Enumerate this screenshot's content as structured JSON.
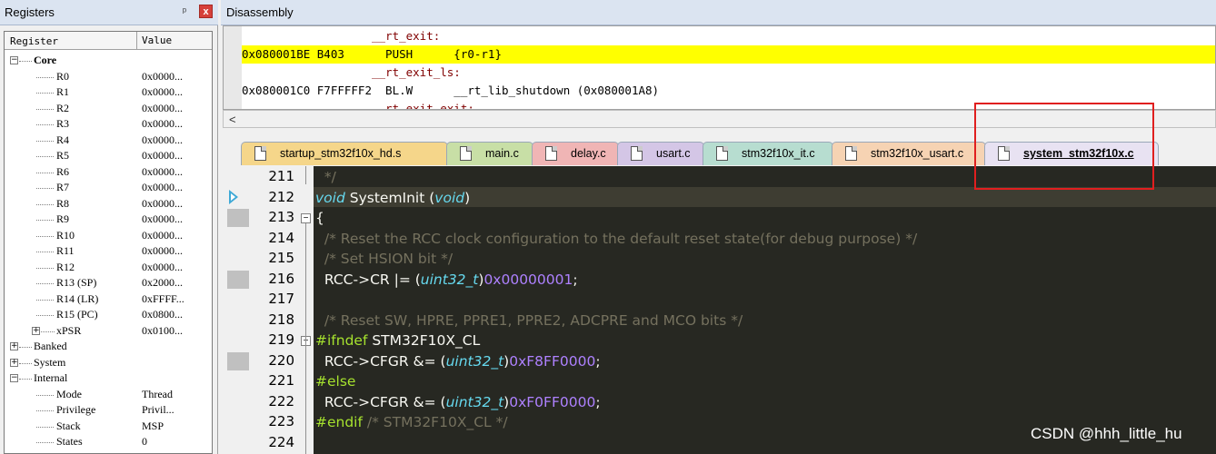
{
  "registers": {
    "title": "Registers",
    "pin_glyph": "ᵖ",
    "close_glyph": "x",
    "col_register": "Register",
    "col_value": "Value",
    "rows": [
      {
        "name": "Core",
        "value": "",
        "indent": 0,
        "toggle": "−",
        "bold": true
      },
      {
        "name": "R0",
        "value": "0x0000...",
        "indent": 2
      },
      {
        "name": "R1",
        "value": "0x0000...",
        "indent": 2
      },
      {
        "name": "R2",
        "value": "0x0000...",
        "indent": 2
      },
      {
        "name": "R3",
        "value": "0x0000...",
        "indent": 2
      },
      {
        "name": "R4",
        "value": "0x0000...",
        "indent": 2
      },
      {
        "name": "R5",
        "value": "0x0000...",
        "indent": 2
      },
      {
        "name": "R6",
        "value": "0x0000...",
        "indent": 2
      },
      {
        "name": "R7",
        "value": "0x0000...",
        "indent": 2
      },
      {
        "name": "R8",
        "value": "0x0000...",
        "indent": 2
      },
      {
        "name": "R9",
        "value": "0x0000...",
        "indent": 2
      },
      {
        "name": "R10",
        "value": "0x0000...",
        "indent": 2
      },
      {
        "name": "R11",
        "value": "0x0000...",
        "indent": 2
      },
      {
        "name": "R12",
        "value": "0x0000...",
        "indent": 2
      },
      {
        "name": "R13 (SP)",
        "value": "0x2000...",
        "indent": 2
      },
      {
        "name": "R14 (LR)",
        "value": "0xFFFF...",
        "indent": 2
      },
      {
        "name": "R15 (PC)",
        "value": "0x0800...",
        "indent": 2
      },
      {
        "name": "xPSR",
        "value": "0x0100...",
        "indent": 1,
        "toggle": "+"
      },
      {
        "name": "Banked",
        "value": "",
        "indent": 0,
        "toggle": "+"
      },
      {
        "name": "System",
        "value": "",
        "indent": 0,
        "toggle": "+"
      },
      {
        "name": "Internal",
        "value": "",
        "indent": 0,
        "toggle": "−"
      },
      {
        "name": "Mode",
        "value": "Thread",
        "indent": 2
      },
      {
        "name": "Privilege",
        "value": "Privil...",
        "indent": 2
      },
      {
        "name": "Stack",
        "value": "MSP",
        "indent": 2
      },
      {
        "name": "States",
        "value": "0",
        "indent": 2
      }
    ]
  },
  "disassembly": {
    "title": "Disassembly",
    "lines": [
      {
        "text": "                   __rt_exit:",
        "kind": "label"
      },
      {
        "text": "0x080001BE B403      PUSH      {r0-r1}",
        "kind": "highlight"
      },
      {
        "text": "                   __rt_exit_ls:",
        "kind": "label"
      },
      {
        "text": "0x080001C0 F7FFFFF2  BL.W      __rt_lib_shutdown (0x080001A8)",
        "kind": "normal"
      },
      {
        "text": "                   __rt_exit_exit:",
        "kind": "label"
      }
    ],
    "scroll_left_glyph": "<"
  },
  "tabs": [
    {
      "label": "startup_stm32f10x_hd.s",
      "color": "#f5d68a",
      "active": false
    },
    {
      "label": "main.c",
      "color": "#c8dfa6",
      "active": false
    },
    {
      "label": "delay.c",
      "color": "#f0b5b5",
      "active": false
    },
    {
      "label": "usart.c",
      "color": "#d4c6e6",
      "active": false
    },
    {
      "label": "stm32f10x_it.c",
      "color": "#b7ddd0",
      "active": false
    },
    {
      "label": "stm32f10x_usart.c",
      "color": "#f6d3b3",
      "active": false
    },
    {
      "label": "system_stm32f10x.c",
      "color": "#e8e2f2",
      "active": true
    }
  ],
  "editor": {
    "current_line": "212",
    "lines": [
      {
        "num": "211",
        "parts": [
          {
            "t": "  */",
            "c": "cm"
          }
        ]
      },
      {
        "num": "212",
        "parts": [
          {
            "t": "void",
            "c": "kw"
          },
          {
            "t": " SystemInit (",
            "c": "op"
          },
          {
            "t": "void",
            "c": "kw"
          },
          {
            "t": ")",
            "c": "op"
          }
        ]
      },
      {
        "num": "213",
        "parts": [
          {
            "t": "{",
            "c": "op"
          }
        ],
        "fold": "−"
      },
      {
        "num": "214",
        "parts": [
          {
            "t": "  /* Reset the RCC clock configuration to the default reset state(for debug purpose) */",
            "c": "cm"
          }
        ]
      },
      {
        "num": "215",
        "parts": [
          {
            "t": "  /* Set HSION bit */",
            "c": "cm"
          }
        ]
      },
      {
        "num": "216",
        "parts": [
          {
            "t": "  RCC->CR |= (",
            "c": "op"
          },
          {
            "t": "uint32_t",
            "c": "kw"
          },
          {
            "t": ")",
            "c": "op"
          },
          {
            "t": "0x00000001",
            "c": "num"
          },
          {
            "t": ";",
            "c": "op"
          }
        ]
      },
      {
        "num": "217",
        "parts": [
          {
            "t": "",
            "c": "op"
          }
        ]
      },
      {
        "num": "218",
        "parts": [
          {
            "t": "  /* Reset SW, HPRE, PPRE1, PPRE2, ADCPRE and MCO bits */",
            "c": "cm"
          }
        ]
      },
      {
        "num": "219",
        "parts": [
          {
            "t": "#ifndef",
            "c": "pp"
          },
          {
            "t": " STM32F10X_CL",
            "c": "op"
          }
        ],
        "fold": "−"
      },
      {
        "num": "220",
        "parts": [
          {
            "t": "  RCC->CFGR &= (",
            "c": "op"
          },
          {
            "t": "uint32_t",
            "c": "kw"
          },
          {
            "t": ")",
            "c": "op"
          },
          {
            "t": "0xF8FF0000",
            "c": "num"
          },
          {
            "t": ";",
            "c": "op"
          }
        ]
      },
      {
        "num": "221",
        "parts": [
          {
            "t": "#else",
            "c": "pp"
          }
        ]
      },
      {
        "num": "222",
        "parts": [
          {
            "t": "  RCC->CFGR &= (",
            "c": "op"
          },
          {
            "t": "uint32_t",
            "c": "kw"
          },
          {
            "t": ")",
            "c": "op"
          },
          {
            "t": "0xF0FF0000",
            "c": "num"
          },
          {
            "t": ";",
            "c": "op"
          }
        ]
      },
      {
        "num": "223",
        "parts": [
          {
            "t": "#endif",
            "c": "pp"
          },
          {
            "t": " /* STM32F10X_CL */",
            "c": "cm"
          }
        ]
      },
      {
        "num": "224",
        "parts": [
          {
            "t": "",
            "c": "op"
          }
        ]
      }
    ],
    "breakpoint_rows": [
      "213",
      "216",
      "220"
    ]
  },
  "watermark": "CSDN @hhh_little_hu"
}
